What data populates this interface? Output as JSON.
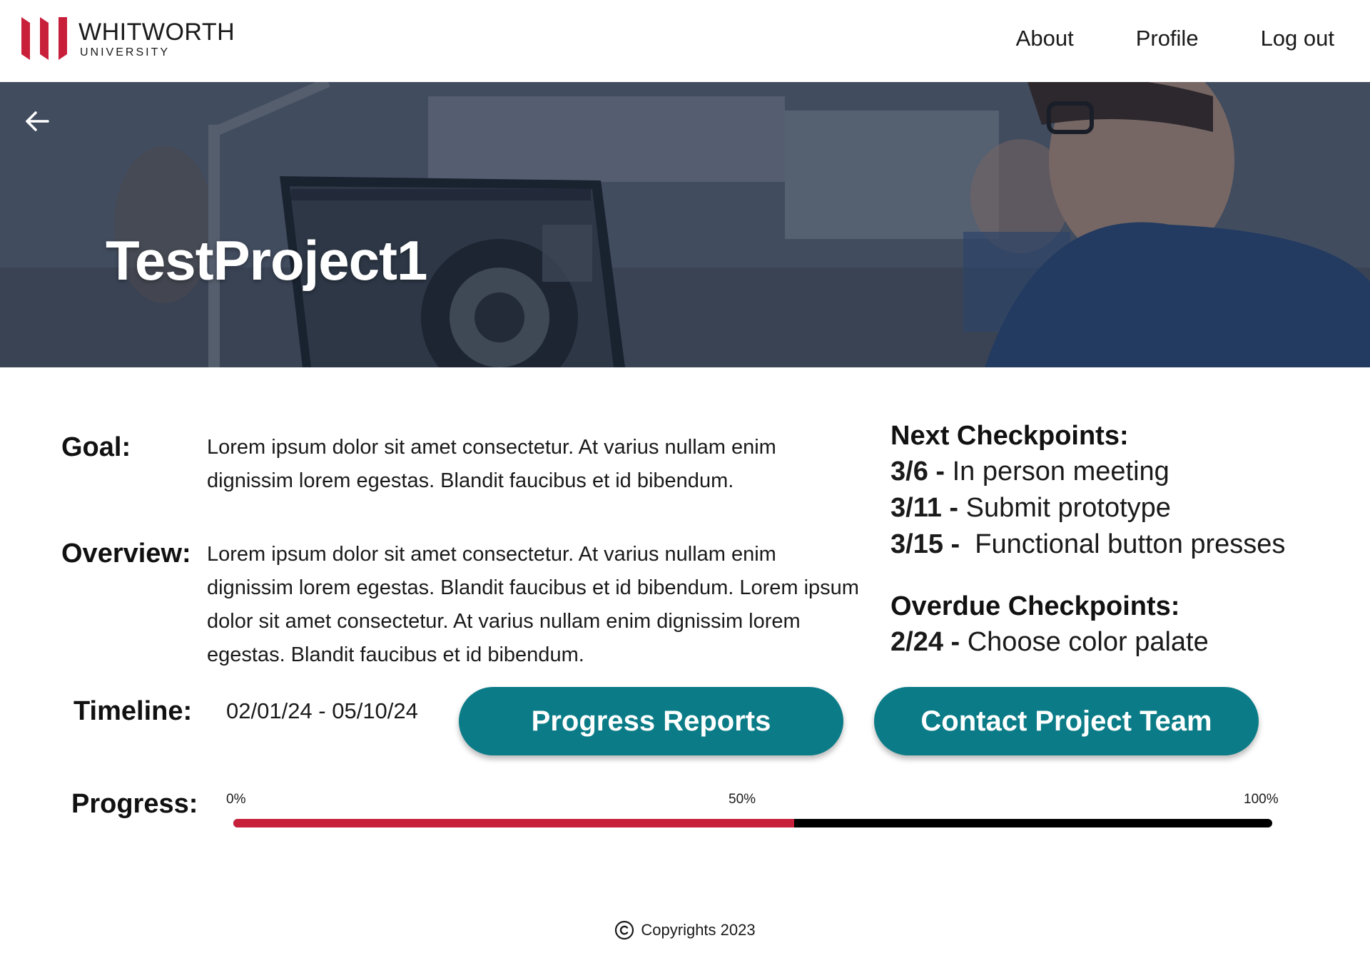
{
  "brand": {
    "name": "WHITWORTH",
    "sub": "UNIVERSITY",
    "color": "#c8203b"
  },
  "nav": {
    "links": [
      "About",
      "Profile",
      "Log out"
    ]
  },
  "hero": {
    "title": "TestProject1",
    "back_icon": "arrow-left-icon"
  },
  "goal": {
    "label": "Goal:",
    "text": "Lorem ipsum dolor sit amet consectetur. At varius nullam enim dignissim lorem egestas. Blandit faucibus et id bibendum."
  },
  "overview": {
    "label": "Overview:",
    "text": "Lorem ipsum dolor sit amet consectetur. At varius nullam enim dignissim lorem egestas. Blandit faucibus et id bibendum. Lorem ipsum dolor sit amet consectetur. At varius nullam enim dignissim lorem egestas. Blandit faucibus et id bibendum."
  },
  "checkpoints": {
    "next_heading": "Next Checkpoints:",
    "next": [
      {
        "date": "3/6 - ",
        "text": "In person meeting"
      },
      {
        "date": "3/11 - ",
        "text": "Submit prototype"
      },
      {
        "date": "3/15 - ",
        "text": " Functional button presses"
      }
    ],
    "overdue_heading": "Overdue Checkpoints:",
    "overdue": [
      {
        "date": "2/24 - ",
        "text": "Choose color palate"
      }
    ]
  },
  "timeline": {
    "label": "Timeline:",
    "value": "02/01/24 - 05/10/24"
  },
  "buttons": {
    "progress_reports": "Progress Reports",
    "contact_team": "Contact Project Team",
    "color": "#0b7c87"
  },
  "progress": {
    "label": "Progress:",
    "ticks": [
      "0%",
      "50%",
      "100%"
    ],
    "percent": 54,
    "fill_color": "#c8203b",
    "track_color": "#000000"
  },
  "footer": {
    "text": "Copyrights 2023",
    "icon": "copyright-icon"
  }
}
